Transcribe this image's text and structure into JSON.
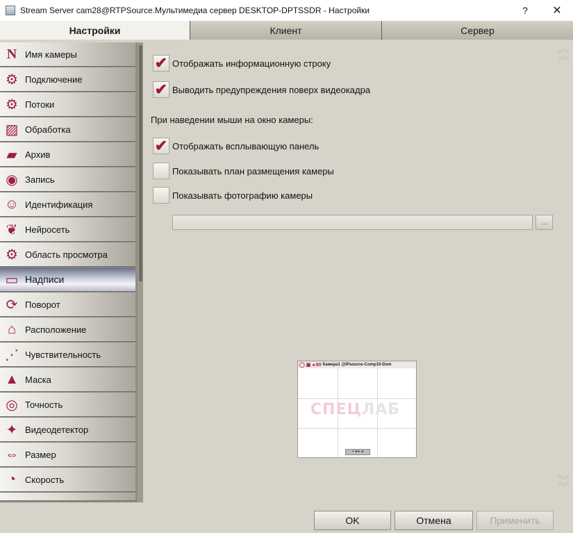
{
  "window": {
    "title": "Stream Server cam28@RTPSource.Мультимедиа сервер DESKTOP-DPTSSDR - Настройки",
    "help_label": "?",
    "close_label": "✕"
  },
  "tabs": [
    {
      "label": "Настройки",
      "active": true
    },
    {
      "label": "Клиент",
      "active": false
    },
    {
      "label": "Сервер",
      "active": false
    }
  ],
  "sidebar": {
    "items": [
      {
        "label": "Имя камеры",
        "icon": "camera-name-icon",
        "glyph": "N"
      },
      {
        "label": "Подключение",
        "icon": "gear-icon",
        "glyph": "⚙"
      },
      {
        "label": "Потоки",
        "icon": "gear-icon",
        "glyph": "⚙"
      },
      {
        "label": "Обработка",
        "icon": "processing-icon",
        "glyph": "▨"
      },
      {
        "label": "Архив",
        "icon": "folder-icon",
        "glyph": "▰"
      },
      {
        "label": "Запись",
        "icon": "record-icon",
        "glyph": "◉"
      },
      {
        "label": "Идентификация",
        "icon": "face-id-icon",
        "glyph": "☺"
      },
      {
        "label": "Нейросеть",
        "icon": "brain-icon",
        "glyph": "❦"
      },
      {
        "label": "Область просмотра",
        "icon": "gear-icon",
        "glyph": "⚙"
      },
      {
        "label": "Надписи",
        "icon": "captions-icon",
        "glyph": "▭",
        "active": true
      },
      {
        "label": "Поворот",
        "icon": "rotate-icon",
        "glyph": "⟳"
      },
      {
        "label": "Расположение",
        "icon": "house-icon",
        "glyph": "⌂"
      },
      {
        "label": "Чувствительность",
        "icon": "sensitivity-icon",
        "glyph": "⋰"
      },
      {
        "label": "Маска",
        "icon": "mask-icon",
        "glyph": "▲"
      },
      {
        "label": "Точность",
        "icon": "target-icon",
        "glyph": "◎"
      },
      {
        "label": "Видеодетектор",
        "icon": "motion-detector-icon",
        "glyph": "✦"
      },
      {
        "label": "Размер",
        "icon": "size-icon",
        "glyph": "⇔"
      },
      {
        "label": "Скорость",
        "icon": "speedometer-icon",
        "glyph": "◔"
      }
    ]
  },
  "content": {
    "options": [
      {
        "label": "Отображать информационную строку",
        "checked": true
      },
      {
        "label": "Выводить предупреждения поверх видеокадра",
        "checked": true
      }
    ],
    "hover_section_label": "При наведении мыши на окно камеры:",
    "hover_options": [
      {
        "label": "Отображать всплывающую панель",
        "checked": true
      },
      {
        "label": "Показывать план размещения камеры",
        "checked": false
      },
      {
        "label": "Показывать фотографию камеры",
        "checked": false
      }
    ],
    "photo_path": "",
    "browse_label": "...",
    "check_glyph": "✔"
  },
  "preview": {
    "bar_text": "Камера1 @IPsource-Comp10-Dom",
    "bar_icons": "◯ ▣ ◂ 80",
    "logo_a": "СПЕЦ",
    "logo_b": "ЛАБ",
    "panel_text": "▪ ◂ ▸ ◂"
  },
  "buttons": {
    "ok": "OK",
    "cancel": "Отмена",
    "apply": "Применить"
  },
  "colors": {
    "accent": "#9c1e46",
    "sidebar_bg": "#8f8c81",
    "content_bg": "#d6d3c9"
  }
}
